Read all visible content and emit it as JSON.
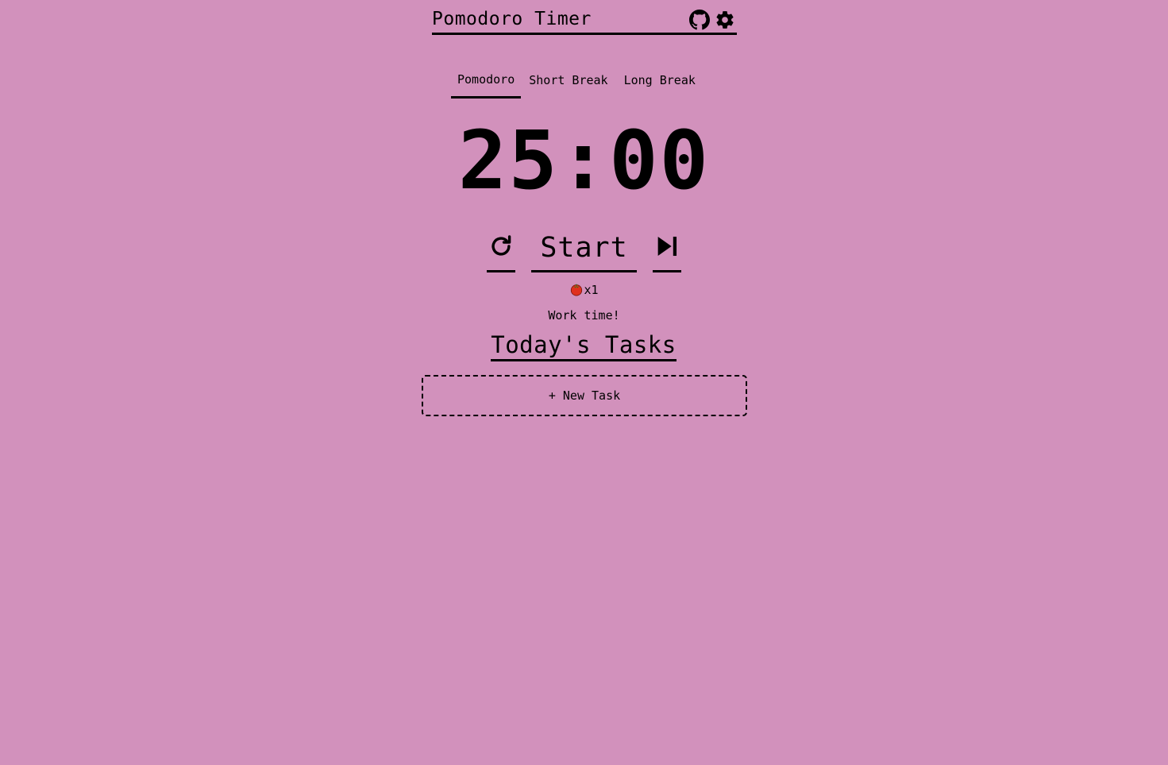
{
  "header": {
    "title": "Pomodoro Timer",
    "icons": [
      "github-icon",
      "gear-icon"
    ]
  },
  "tabs": [
    {
      "label": "Pomodoro",
      "active": true
    },
    {
      "label": "Short Break",
      "active": false
    },
    {
      "label": "Long Break",
      "active": false
    }
  ],
  "timer": {
    "display": "25:00"
  },
  "controls": {
    "reset_icon": "reset-icon",
    "start_label": "Start",
    "skip_icon": "skip-icon"
  },
  "session": {
    "icon": "tomato-icon",
    "count": "x1",
    "status": "Work time!"
  },
  "tasks": {
    "title": "Today's Tasks",
    "new_task_label": "+ New Task"
  },
  "colors": {
    "background": "#d291bc",
    "foreground": "#000000",
    "tomato": "#e0301e"
  }
}
